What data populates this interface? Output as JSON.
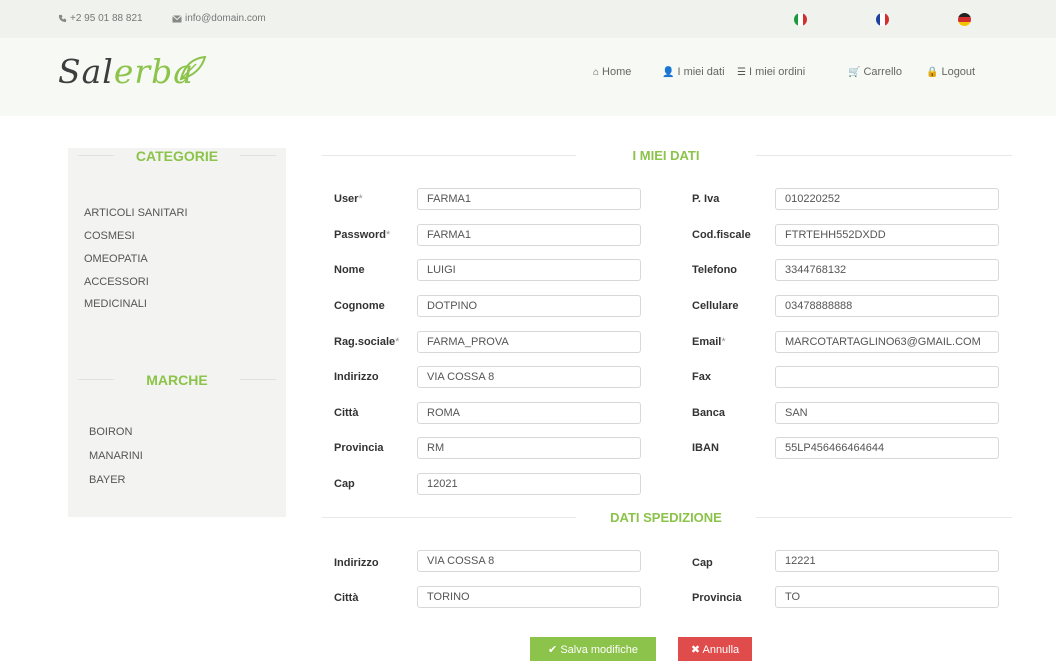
{
  "topbar": {
    "phone": "+2 95 01 88 821",
    "email": "info@domain.com",
    "languages": [
      "it",
      "fr",
      "de"
    ]
  },
  "logo": {
    "text_a": "Sal",
    "text_b": "erba"
  },
  "nav": {
    "home": "Home",
    "miei_dati": "I miei dati",
    "miei_ordini": "I miei ordini",
    "carrello": "Carrello",
    "logout": "Logout"
  },
  "sidebar": {
    "categorie_title": "CATEGORIE",
    "categorie": [
      "ARTICOLI SANITARI",
      "COSMESI",
      "OMEOPATIA",
      "ACCESSORI",
      "MEDICINALI"
    ],
    "marche_title": "MARCHE",
    "marche": [
      "BOIRON",
      "MANARINI",
      "BAYER"
    ]
  },
  "form": {
    "title": "I MIEI DATI",
    "left": [
      {
        "label": "User",
        "required": true,
        "value": "FARMA1"
      },
      {
        "label": "Password",
        "required": true,
        "value": "FARMA1"
      },
      {
        "label": "Nome",
        "required": false,
        "value": "LUIGI"
      },
      {
        "label": "Cognome",
        "required": false,
        "value": "DOTPINO"
      },
      {
        "label": "Rag.sociale",
        "required": true,
        "value": "FARMA_PROVA"
      },
      {
        "label": "Indirizzo",
        "required": false,
        "value": "VIA COSSA 8"
      },
      {
        "label": "Città",
        "required": false,
        "value": "ROMA"
      },
      {
        "label": "Provincia",
        "required": false,
        "value": "RM"
      },
      {
        "label": "Cap",
        "required": false,
        "value": "12021"
      }
    ],
    "right": [
      {
        "label": "P. Iva",
        "required": false,
        "value": "010220252"
      },
      {
        "label": "Cod.fiscale",
        "required": false,
        "value": "FTRTEHH552DXDD"
      },
      {
        "label": "Telefono",
        "required": false,
        "value": "3344768132"
      },
      {
        "label": "Cellulare",
        "required": false,
        "value": "03478888888"
      },
      {
        "label": "Email",
        "required": true,
        "value": "MARCOTARTAGLINO63@GMAIL.COM"
      },
      {
        "label": "Fax",
        "required": false,
        "value": ""
      },
      {
        "label": "Banca",
        "required": false,
        "value": "SAN"
      },
      {
        "label": "IBAN",
        "required": false,
        "value": "55LP456466464644"
      }
    ]
  },
  "shipping": {
    "title": "DATI SPEDIZIONE",
    "left": [
      {
        "label": "Indirizzo",
        "value": "VIA COSSA 8"
      },
      {
        "label": "Città",
        "value": "TORINO"
      }
    ],
    "right": [
      {
        "label": "Cap",
        "value": "12221"
      },
      {
        "label": "Provincia",
        "value": "TO"
      }
    ]
  },
  "buttons": {
    "save": "Salva modifiche",
    "cancel": "Annulla"
  },
  "colors": {
    "accent": "#8cc34a",
    "danger": "#e04b4b"
  }
}
